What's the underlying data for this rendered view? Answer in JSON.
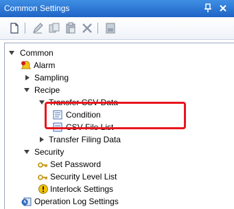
{
  "window": {
    "title": "Common Settings"
  },
  "toolbar": {
    "buttons": [
      "new-icon",
      "edit-icon",
      "copy-icon",
      "paste-icon",
      "delete-icon",
      "properties-icon"
    ]
  },
  "tree": {
    "common": "Common",
    "alarm": "Alarm",
    "sampling": "Sampling",
    "recipe": "Recipe",
    "transfer_csv_data": "Transfer CSV Data",
    "condition": "Condition",
    "csv_file_list": "CSV File List",
    "transfer_filing_data": "Transfer Filing Data",
    "security": "Security",
    "set_password": "Set Password",
    "security_level_list": "Security Level List",
    "interlock_settings": "Interlock Settings",
    "operation_log_settings": "Operation Log Settings"
  },
  "colors": {
    "title_bar": "#2a72d6",
    "highlight": "#e8141c",
    "selection_hint": "none"
  }
}
